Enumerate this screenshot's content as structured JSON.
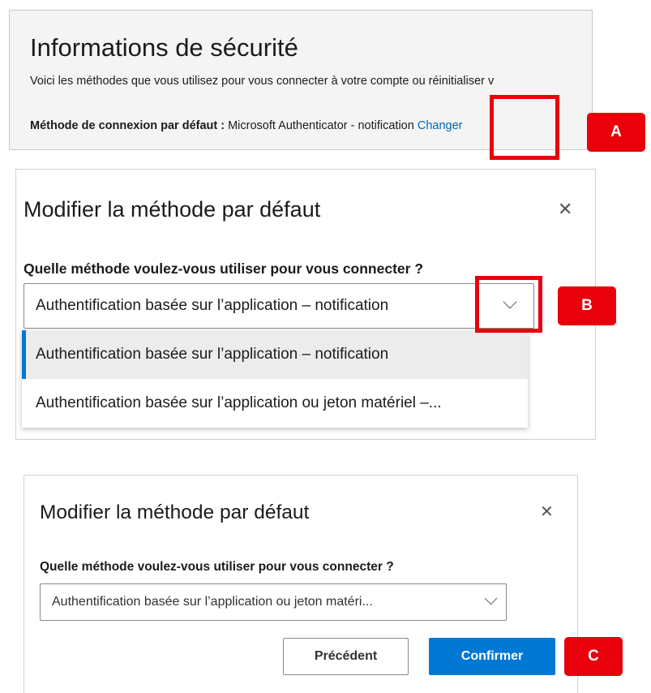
{
  "security_info": {
    "title": "Informations de sécurité",
    "description": "Voici les méthodes que vous utilisez pour vous connecter à votre compte ou réinitialiser v",
    "default_method_label": "Méthode de connexion par défaut :",
    "default_method_value_part1": " Microsoft Authenticator - notificati",
    "default_method_value_part2": "on ",
    "change_link": "Changer"
  },
  "callouts": {
    "a": "A",
    "b": "B",
    "c": "C"
  },
  "dialog_dropdown_open": {
    "title": "Modifier la méthode par défaut",
    "question": "Quelle méthode voulez-vous utiliser pour vous connecter ?",
    "selected_value": "Authentification basée sur l’application – notification",
    "options": [
      {
        "label": "Authentification basée sur l’application – notification",
        "selected": true
      },
      {
        "label": "Authentification basée sur l’application ou jeton matériel –...",
        "selected": false
      }
    ]
  },
  "dialog_confirm": {
    "title": "Modifier la méthode par défaut",
    "question": "Quelle méthode voulez-vous utiliser pour vous connecter ?",
    "selected_value": "Authentification basée sur l’application ou jeton matéri...",
    "prev_button": "Précédent",
    "confirm_button": "Confirmer"
  },
  "icons": {
    "close": "close-icon",
    "dropdown": "chevron-down-icon"
  },
  "colors": {
    "accent": "#0078d4",
    "link": "#0067b8",
    "highlight": "#e8000b",
    "panel_bg": "#f4f4f4",
    "selected_option_bg": "#ececec"
  }
}
